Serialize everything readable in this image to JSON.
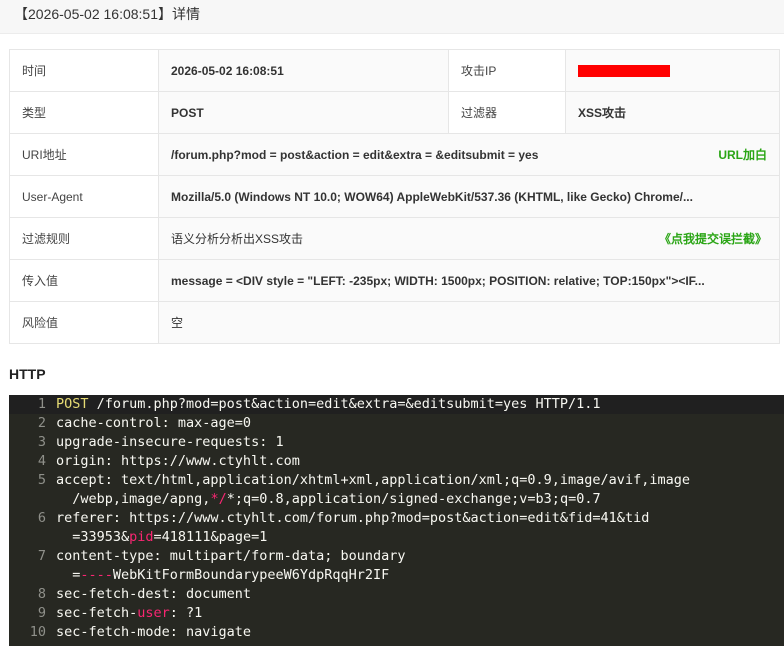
{
  "title": "【2026-05-02 16:08:51】详情",
  "details": {
    "time_label": "时间",
    "time_value": "2026-05-02 16:08:51",
    "ip_label": "攻击IP",
    "type_label": "类型",
    "type_value": "POST",
    "filter_label": "过滤器",
    "filter_value": "XSS攻击",
    "uri_label": "URI地址",
    "uri_value": "/forum.php?mod = post&action = edit&extra = &editsubmit = yes",
    "uri_action": "URL加白",
    "ua_label": "User-Agent",
    "ua_value": "Mozilla/5.0 (Windows NT 10.0; WOW64) AppleWebKit/537.36 (KHTML, like Gecko) Chrome/...",
    "rule_label": "过滤规则",
    "rule_value": "语义分析分析出XSS攻击",
    "rule_action": "《点我提交误拦截》",
    "input_label": "传入值",
    "input_value": "message = <DIV style = \"LEFT: -235px; WIDTH: 1500px; POSITION: relative; TOP:150px\"><IF...",
    "risk_label": "风险值",
    "risk_value": "空"
  },
  "colors": {
    "redaction": "#ff0000",
    "green_action": "#2aa515",
    "code_bg": "#272822"
  },
  "http_heading": "HTTP",
  "http_lines": [
    {
      "n": "1",
      "a": "POST /forum.php?mod=post&action=edit&extra=&editsubmit=yes HTTP/1.1"
    },
    {
      "n": "2",
      "a": "cache-control: max-age=0"
    },
    {
      "n": "3",
      "a": "upgrade-insecure-requests: 1"
    },
    {
      "n": "4",
      "a": "origin: https://www.ctyhlt.com"
    },
    {
      "n": "5",
      "a": "accept: text/html,application/xhtml+xml,application/xml;q=0.9,image/avif,image"
    },
    {
      "n": "",
      "a": "  /webp,image/apng,",
      "r": "*/",
      "b": "*;q=0.8,application/signed-exchange;v=b3;q=0.7"
    },
    {
      "n": "6",
      "a": "referer: https://www.ctyhlt.com/forum.php?mod=post&action=edit&fid=41&tid"
    },
    {
      "n": "",
      "a": "  =33953&",
      "r": "pid",
      "b": "=418111&page=1"
    },
    {
      "n": "7",
      "a": "content-type: multipart/form-data; boundary"
    },
    {
      "n": "",
      "a": "  =",
      "r": "----",
      "b": "WebKitFormBoundarypeeW6YdpRqqHr2IF"
    },
    {
      "n": "8",
      "a": "sec-fetch-dest: document"
    },
    {
      "n": "9",
      "a": "sec-fetch-",
      "r": "user",
      "b": ": ?1"
    },
    {
      "n": "10",
      "a": "sec-fetch-mode: navigate"
    }
  ]
}
